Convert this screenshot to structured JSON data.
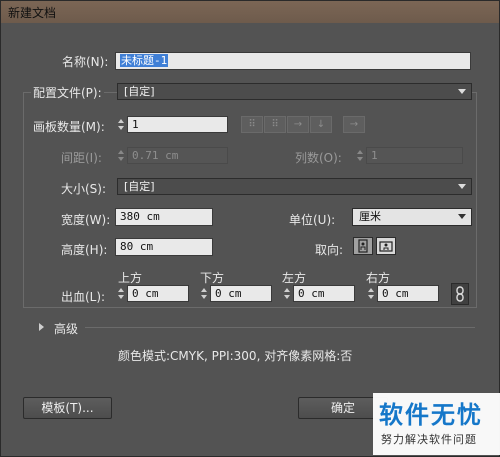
{
  "window": {
    "title": "新建文档"
  },
  "name": {
    "label": "名称(N):",
    "value": "未标题-1"
  },
  "profile": {
    "label": "配置文件(P):",
    "value": "[自定]"
  },
  "artboards": {
    "label": "画板数量(M):",
    "value": "1"
  },
  "spacing": {
    "label": "间距(I):",
    "value": "0.71 cm"
  },
  "columns": {
    "label": "列数(O):",
    "value": "1"
  },
  "size": {
    "label": "大小(S):",
    "value": "[自定]"
  },
  "width": {
    "label": "宽度(W):",
    "value": "380 cm"
  },
  "units": {
    "label": "单位(U):",
    "value": "厘米"
  },
  "height": {
    "label": "高度(H):",
    "value": "80 cm"
  },
  "orientation": {
    "label": "取向:"
  },
  "bleed": {
    "label": "出血(L):",
    "top": {
      "label": "上方",
      "value": "0 cm"
    },
    "bottom": {
      "label": "下方",
      "value": "0 cm"
    },
    "left": {
      "label": "左方",
      "value": "0 cm"
    },
    "right": {
      "label": "右方",
      "value": "0 cm"
    }
  },
  "advanced": {
    "label": "高级"
  },
  "info": "颜色模式:CMYK, PPI:300, 对齐像素网格:否",
  "buttons": {
    "template": "模板(T)...",
    "ok": "确定"
  },
  "watermark": {
    "title": "软件无忧",
    "subtitle": "努力解决软件问题"
  }
}
